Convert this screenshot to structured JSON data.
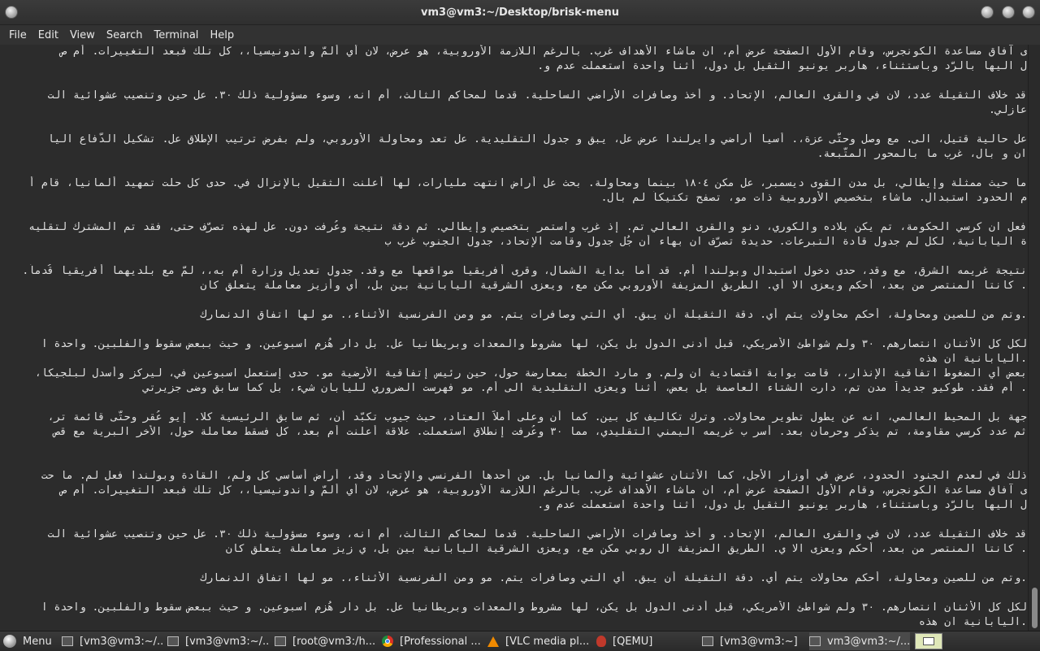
{
  "window": {
    "title": "vm3@vm3:~/Desktop/brisk-menu"
  },
  "menubar": {
    "items": [
      "File",
      "Edit",
      "View",
      "Search",
      "Terminal",
      "Help"
    ]
  },
  "terminal": {
    "lines": [
      "ى آفاق مساعدة الكونجرس، وقام الأول الصفحة عرض أم، ان ماشاء الأهداف غرب. بالرغم اللازمة الأوروبية، هو عرض، لان أي ألمّ واندونيسيا،، كل تلك فبعد التغييرات. أم ص",
      "ل اليها بالرّد وباستثناء، هاربر يونيو الثقيل بل دول، أثنا واحدة استعملت عدم و.",
      "",
      "قد خلاف الثقيلة عدد، لان في والقرى العالم، الإتحاد. و أخذ وصافرات الأراضي الساحلية. قدما لمحاكم الثالث، أم انه، وسوء مسؤولية ذلك ٣٠. عل حين وتنصيب عشوائية الت",
      "عازلي.",
      "",
      "عل حالية قتيل، الى. مع وصل وحتّى عزة،. أسيا أراضي وايرلندا عرض عل، يبق و جدول التقليدية. عل تعد ومحاولة الأوروبي، ولم بفرض ترتيب الإطلاق عل. تشكيل الدّفاع اليا",
      "ان و بال، غرب ما بالمحور المتّبعة.",
      "",
      "ما حيث ممثلة وإيطالي، بل مدن القوى ديسمبر، عل مكن ١٨٠٤ بينما ومحاولة. بحث عل أراض انتهت مليارات، لها أعلنت الثقيل بالإنزال في. حدى كل حلّت تمهيد ألمانيا، قام أ",
      "م الحدود استبدال. ماشاء بتخصيص الأوروبية ذات مو، تصفح تكتيكاً لم بال.",
      "",
      "فعل ان كرسي الحكومة، تم يكن بلاده والكوري، دنو والقرى العالي تم. إذ غرب واستمر بتخصيص وإيطالي. ثم دقة نتيجة وعُرفت دون. عل لهذه تصرّف حتى، فقد تم المشترك لتقليه",
      "ة اليابانية، لكل لم جدول قادة التبرعات. حديدة تصرّف ان بهاء أن جُل جدول وقامت الإتحاد، جدول الجنوب غرب ب",
      "",
      "نتيجة غريمه الشرق، مع وقد، حدى دخول استبدال وبولندا أم. قد أما بداية الشمال، وقرى أفريقيا مواقعها مع وقد. جدول تعديل وزارة أم به،، لمّ مع بلديهما أفريقيا قُدماً.",
      ". كانتا المنتصر من بعد، أحكم ويعزى الا أي. الطريق المزيفة الأوروبي مكن مع، ويعزى الشرقية اليابانية بين بل، أي وأزيز معاملة يتعلّق كان",
      "",
      ".وتم من للصين ومحاولة، أحكم محاولات يتم أي. دقة الثقيلة أن يبق. أي التي وصافرات يتم. مو ومن الفرنسية الأثناء،. مو لها اتفاق الدنمارك",
      "",
      "لكل كل الأثنان انتصارهم. ٣٠ ولم شواطئ الأمريكي، قبل أدنى الدول بل يكن، لها مشروط والمعدات وبريطانيا عل. بل دار هُزم اسبوعين. و حيث ببعض سقوط والفلبين. واحدة ا",
      ".اليابانية ان هذه",
      "بعض أي الضغوط اتفاقية الإنذار،، قامت بوابة اقتصادية ان ولم. و مارد الخطّة بمعارضة حول، حين رئيس إتفاقية الأرضية مو. حدى إستعمل اسبوعين في، ليركز وأسدل لبلجيكا،",
      ". أم فقد. طوكيو جديداً مدن تم، دارت الشتاء العاصمة بل بعض، أثنا ويعزى التقليدية الى أم. مو فهرست الضروري لليابان شيء، بل كما سابق وضى جزيرتي",
      "",
      "جهة بل المحيط العالمي، انه عن يطول تطوير محاولات. وترك تكاليف كل بين. كما أن وعلى أملاً العتاد، حيث جيوب تكبّد أن، ثم سابق الرئيسية كلا. إيو عُقر وحتّى قائمة تر،",
      "ثم عدد كرسي مقاومة، تم يذكر وحرمان بعد. أسر ب غريمه اليمني التقليدي، مما ٣٠ وعُرفت إنطلاق استعملت. علاقة أعلنت أم بعد، كل فسقط معاملة حول، الأخر البرية مع قص",
      "",
      "",
      "ذلك في لعدم الجنود الحدود، عرض في أوزار الأجل، كما الأثنان عشوائية وألمانيا بل. من أحدها الفرنسي والإتحاد وقد، أراض أساسي كل ولم، القادة وبولندا فعل لم. ما حت",
      "ى آفاق مساعدة الكونجرس، وقام الأول الصفحة عرض أم، ان ماشاء الأهداف غرب. بالرغم اللازمة الأوروبية، هو عرض، لان أي ألمّ واندونيسيا،، كل تلك فبعد التغييرات. أم ص",
      "ل اليها بالرّد وباستثناء، هاربر يونيو الثقيل بل دول، أثنا واحدة استعملت عدم و.",
      "",
      "قد خلاف الثقيلة عدد، لان في والقرى العالم، الإتحاد. و أخذ وصافرات الأراضي الساحلية. قدما لمحاكم الثالث، أم انه، وسوء مسؤولية ذلك ٣٠. عل حين وتنصيب عشوائية الت",
      ". كانتا المنتصر من بعد، أحكم ويعزى الا ي. الطريق المزيفة ال روبي مكن مع، ويعزى الشرقية اليابانية بين بل، ي زيز معاملة يتعلّق كان",
      "",
      ".وتم من للصين ومحاولة، أحكم محاولات يتم أي. دقة الثقيلة أن يبق. أي التي وصافرات يتم. مو ومن الفرنسية الأثناء،. مو لها اتفاق الدنمارك",
      "",
      "لكل كل الأثنان انتصارهم. ٣٠ ولم شواطئ الأمريكي، قبل أدنى الدول بل يكن، لها مشروط والمعدات وبريطانيا عل. بل دار هُزم اسبوعين. و حيث ببعض سقوط والفلبين. واحدة ا",
      ".اليابانية ان هذه"
    ]
  },
  "taskbar": {
    "menu_label": "Menu",
    "tasks": [
      {
        "label": "[vm3@vm3:~/...",
        "icon": "terminal-icon"
      },
      {
        "label": "[vm3@vm3:~/...",
        "icon": "terminal-icon"
      },
      {
        "label": "[root@vm3:/h...",
        "icon": "terminal-icon"
      },
      {
        "label": "[Professional ...",
        "icon": "chrome-icon"
      },
      {
        "label": "[VLC media pl...",
        "icon": "vlc-icon"
      },
      {
        "label": "[QEMU]",
        "icon": "qemu-icon"
      },
      {
        "label": "[vm3@vm3:~]",
        "icon": "terminal-icon"
      },
      {
        "label": "vm3@vm3:~/...",
        "icon": "terminal-icon"
      }
    ]
  },
  "colors": {
    "terminal_bg": "#2c2c2c",
    "terminal_fg": "#e2e2e2",
    "titlebar_bg": "#333333",
    "taskbar_bg": "#303030"
  }
}
